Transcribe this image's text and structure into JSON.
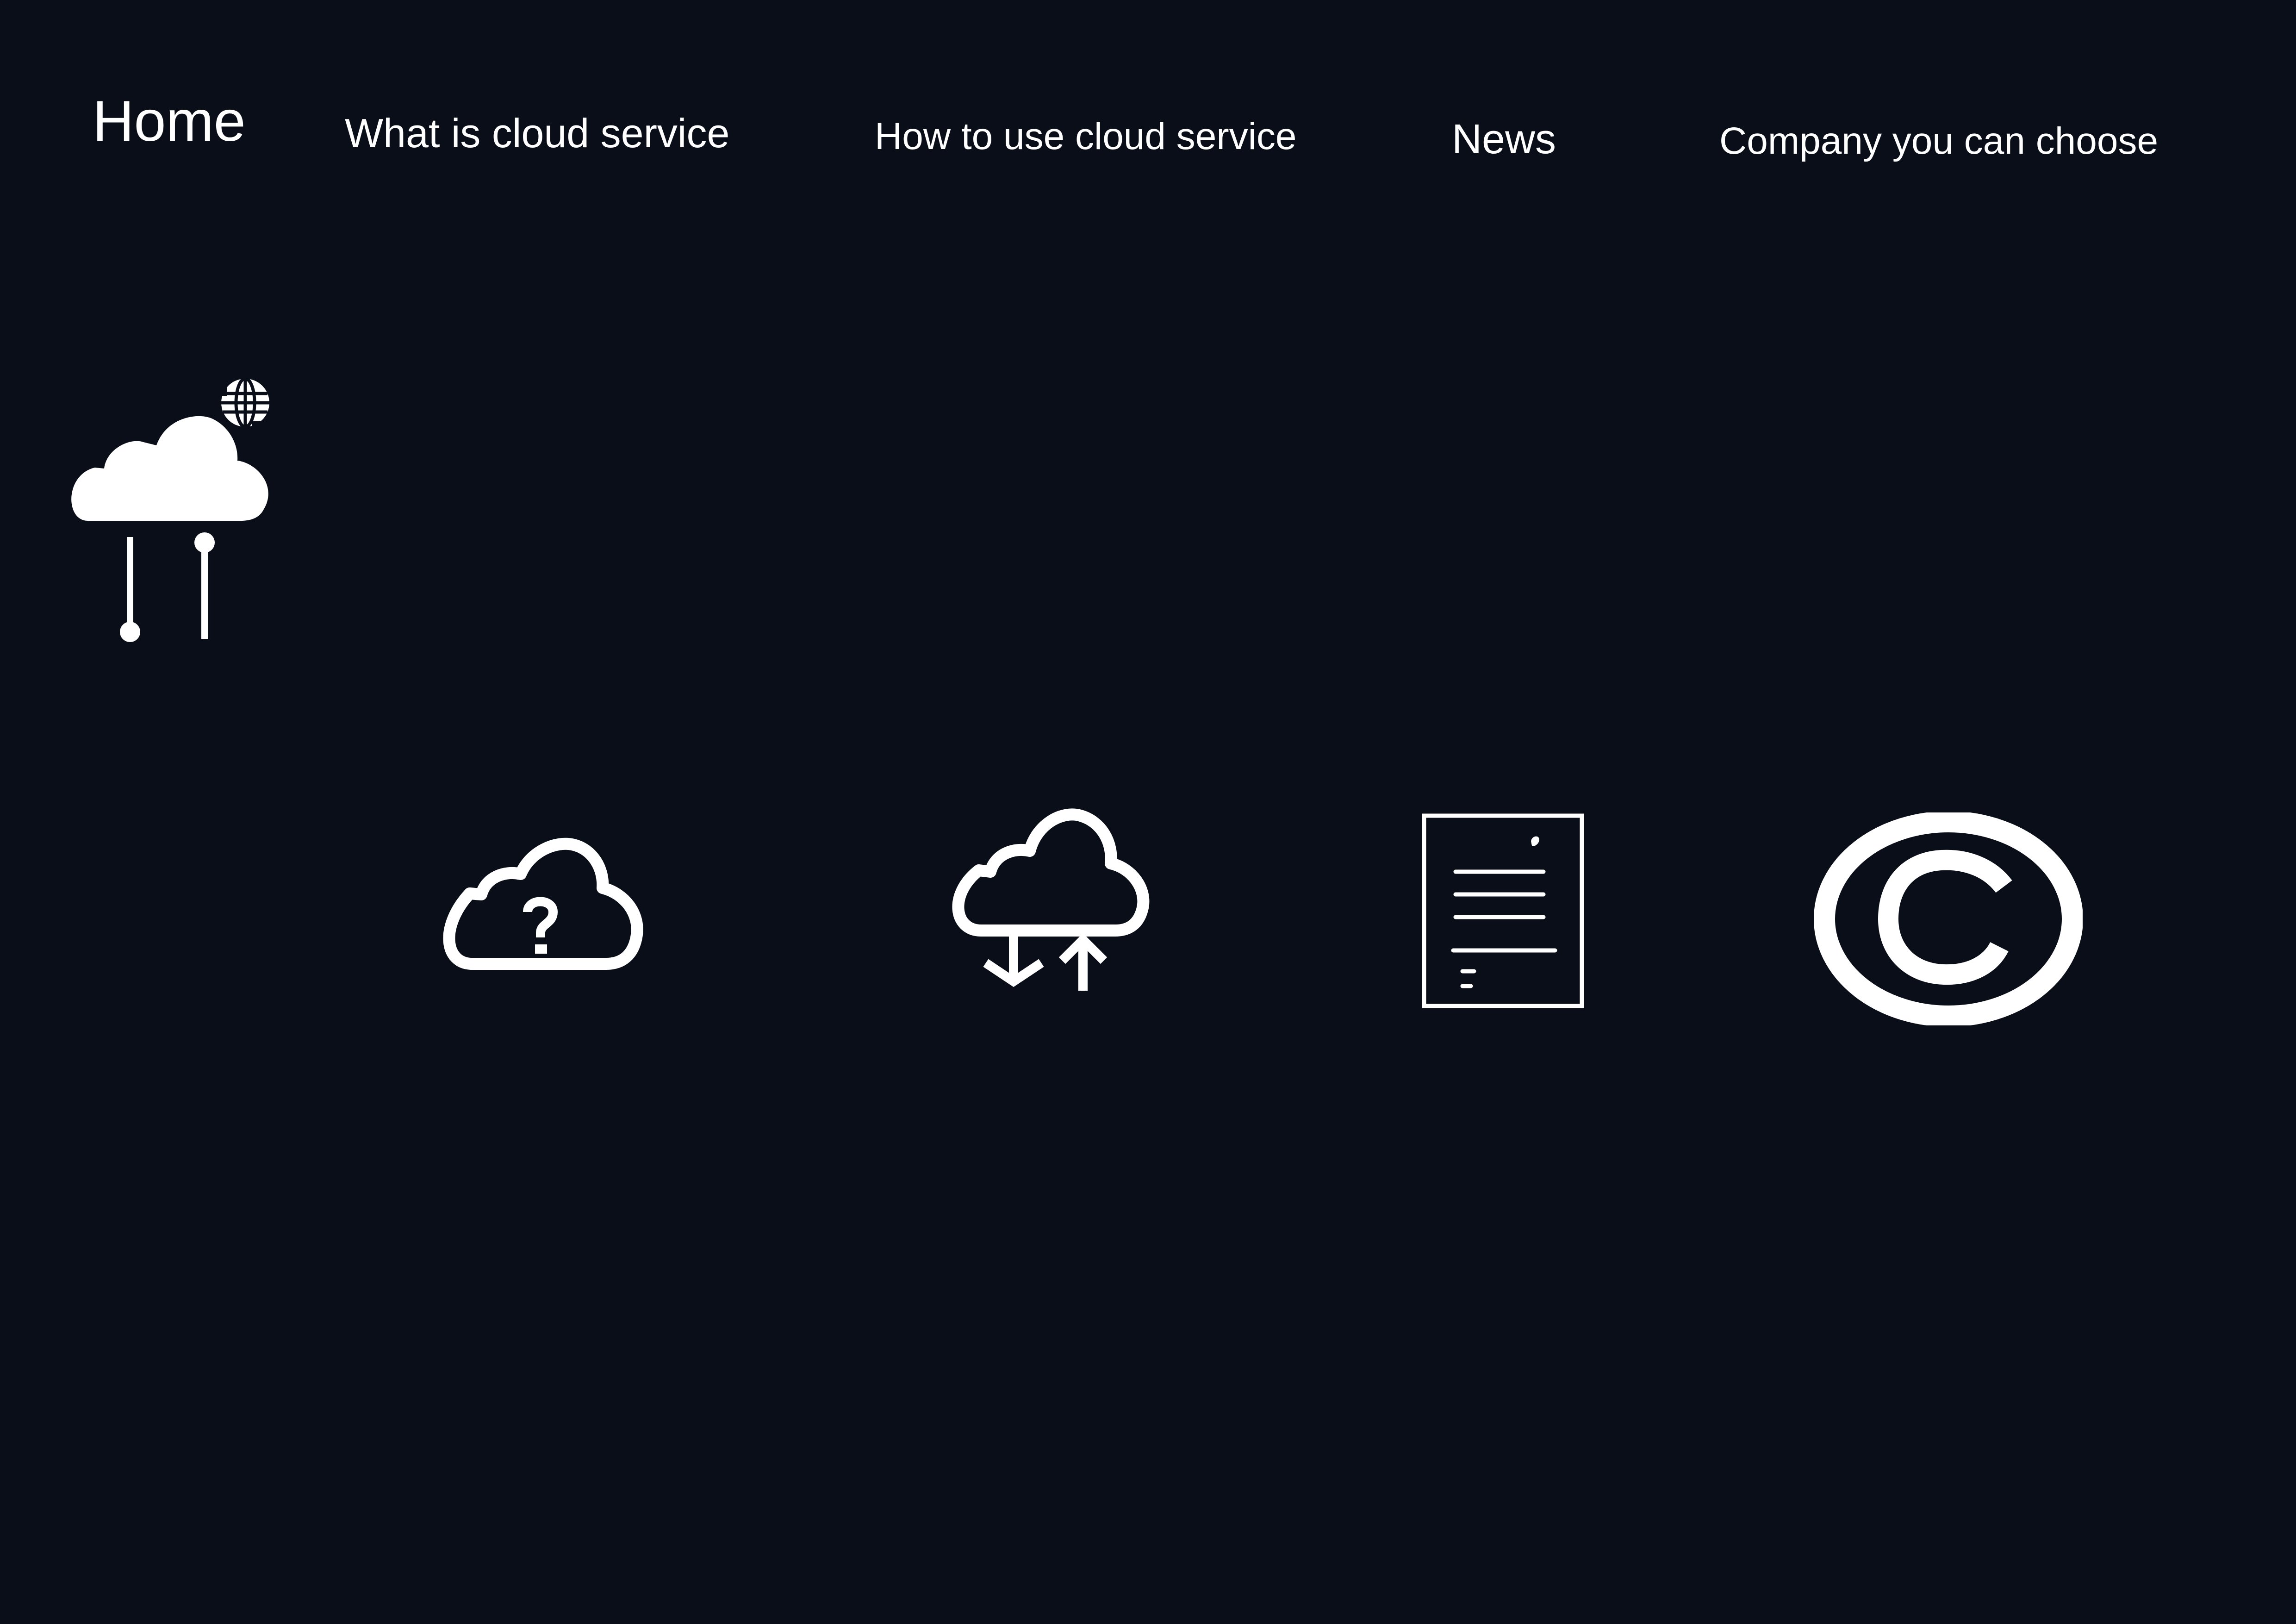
{
  "nav": {
    "home": "Home",
    "what_is": "What is cloud service",
    "how_to_use": "How to use cloud service",
    "news": "News",
    "company": "Company you can choose"
  },
  "icons": {
    "logo": "cloud-network-globe-icon",
    "what_is": "cloud-question-icon",
    "how_to_use": "cloud-upload-download-icon",
    "news": "document-icon",
    "company": "copyright-icon"
  },
  "colors": {
    "background": "#0a0e18",
    "foreground": "#ffffff"
  }
}
